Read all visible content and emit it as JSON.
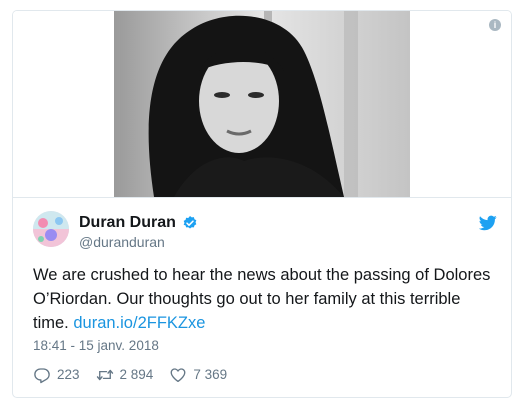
{
  "tweet": {
    "author_name": "Duran Duran",
    "handle": "@duranduran",
    "text": "We are crushed to hear the news about the passing of Dolores O’Riordan. Our thoughts go out to her family at this terrible time.",
    "link_text": "duran.io/2FFKZxe",
    "timestamp": "18:41 - 15 janv. 2018",
    "replies": "223",
    "retweets": "2 894",
    "likes": "7 369"
  },
  "icons": {
    "info": "info-icon",
    "verified": "verified-badge-icon",
    "twitter": "twitter-bird-icon",
    "reply": "reply-icon",
    "retweet": "retweet-icon",
    "like": "heart-icon"
  },
  "colors": {
    "link": "#1b95e0",
    "muted": "#657786",
    "border": "#e1e8ed",
    "verified": "#1da1f2"
  }
}
